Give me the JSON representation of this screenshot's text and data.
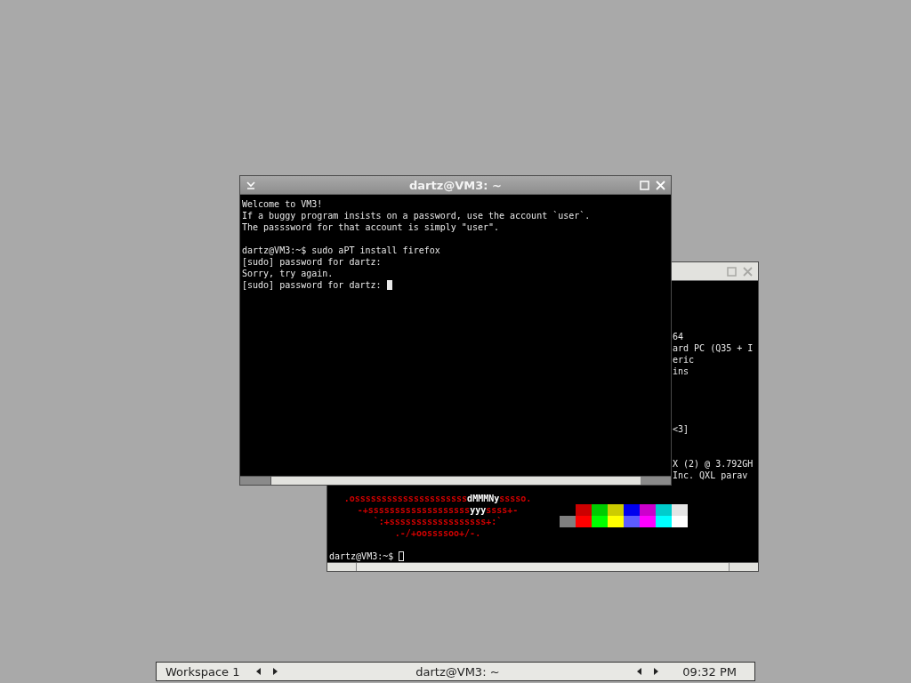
{
  "windows": [
    {
      "focused": false,
      "lines": [
        {
          "kind": "blank"
        },
        {
          "kind": "blank"
        },
        {
          "kind": "blank"
        },
        {
          "kind": "blank"
        },
        {
          "kind": "info",
          "info": "64"
        },
        {
          "kind": "info",
          "info": "ard PC (Q35 + I"
        },
        {
          "kind": "info",
          "info": "eric"
        },
        {
          "kind": "info",
          "info": "ins"
        },
        {
          "kind": "blank"
        },
        {
          "kind": "blank"
        },
        {
          "kind": "blank"
        },
        {
          "kind": "blank"
        },
        {
          "kind": "info",
          "info": "<3]"
        },
        {
          "kind": "blank"
        },
        {
          "kind": "blank"
        },
        {
          "kind": "info",
          "info": "X (2) @ 3.792GH"
        },
        {
          "kind": "info",
          "info": "Inc. QXL parav"
        },
        {
          "kind": "blank"
        },
        {
          "kind": "logo",
          "logo": [
            {
              "text": ".osssssssssssssssssssss",
              "bright": false
            },
            {
              "text": "dMMMNy",
              "bright": true
            },
            {
              "text": "sssso.",
              "bright": false
            }
          ]
        },
        {
          "kind": "logo",
          "logo": [
            {
              "text": "-+sssssssssssssssssss",
              "bright": false
            },
            {
              "text": "yyy",
              "bright": true
            },
            {
              "text": "ssss+-",
              "bright": false
            }
          ],
          "swatches": [
            {
              "color": "#cc0000"
            },
            {
              "color": "#00cc00"
            },
            {
              "color": "#cccc00"
            },
            {
              "color": "#0000ee"
            },
            {
              "color": "#cc00cc"
            },
            {
              "color": "#00cccc"
            },
            {
              "color": "#e5e5e5"
            }
          ]
        },
        {
          "kind": "logo",
          "logo": [
            {
              "text": "`:+ssssssssssssssssss+:`",
              "bright": false
            }
          ],
          "swatches": [
            {
              "color": "#7f7f7f"
            },
            {
              "color": "#ff0000"
            },
            {
              "color": "#00ff00"
            },
            {
              "color": "#ffff00"
            },
            {
              "color": "#5c5cff"
            },
            {
              "color": "#ff00ff"
            },
            {
              "color": "#00ffff"
            },
            {
              "color": "#ffffff"
            }
          ]
        },
        {
          "kind": "logo",
          "logo": [
            {
              "text": ".-/+oossssoo+/-.",
              "bright": false
            }
          ]
        },
        {
          "kind": "blank"
        },
        {
          "kind": "prompt",
          "prompt": "dartz@VM3:~$"
        }
      ]
    },
    {
      "title": "dartz@VM3: ~",
      "focused": true,
      "lines": [
        {
          "kind": "text",
          "text": "Welcome to VM3!"
        },
        {
          "kind": "text",
          "text": "If a buggy program insists on a password, use the account `user`."
        },
        {
          "kind": "text",
          "text": "The passsword for that account is simply \"user\"."
        },
        {
          "kind": "blank"
        },
        {
          "kind": "text",
          "text": "dartz@VM3:~$ sudo aPT install firefox"
        },
        {
          "kind": "text",
          "text": "[sudo] password for dartz:"
        },
        {
          "kind": "text",
          "text": "Sorry, try again."
        },
        {
          "kind": "prompt",
          "prompt": "[sudo] password for dartz:"
        }
      ]
    }
  ],
  "taskbar": {
    "workspace": "Workspace 1",
    "task": "dartz@VM3: ~",
    "clock": "09:32 PM"
  }
}
